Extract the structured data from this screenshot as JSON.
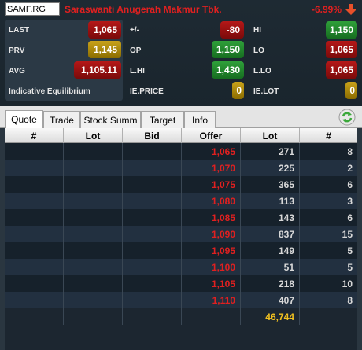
{
  "header": {
    "code": "SAMF.RG",
    "name": "Saraswanti Anugerah Makmur Tbk.",
    "change_pct": "-6.99%",
    "last_label": "LAST",
    "last_value": "1,065",
    "prv_label": "PRV",
    "prv_value": "1,145",
    "avg_label": "AVG",
    "avg_value": "1,105.11",
    "ie_label": "Indicative Equilibrium",
    "chg_label": "+/-",
    "chg_value": "-80",
    "op_label": "OP",
    "op_value": "1,150",
    "lhi_label": "L.HI",
    "lhi_value": "1,430",
    "ieprice_label": "IE.PRICE",
    "ieprice_value": "0",
    "hi_label": "HI",
    "hi_value": "1,150",
    "lo_label": "LO",
    "lo_value": "1,065",
    "llo_label": "L.LO",
    "llo_value": "1,065",
    "ielot_label": "IE.LOT",
    "ielot_value": "0"
  },
  "tabs": [
    "Quote",
    "Trade",
    "Stock Summ",
    "Target",
    "Info"
  ],
  "table": {
    "columns": [
      "#",
      "Lot",
      "Bid",
      "Offer",
      "Lot",
      "#"
    ],
    "rows": [
      {
        "offer": "1,065",
        "lot": "271",
        "count": "8"
      },
      {
        "offer": "1,070",
        "lot": "225",
        "count": "2"
      },
      {
        "offer": "1,075",
        "lot": "365",
        "count": "6"
      },
      {
        "offer": "1,080",
        "lot": "113",
        "count": "3"
      },
      {
        "offer": "1,085",
        "lot": "143",
        "count": "6"
      },
      {
        "offer": "1,090",
        "lot": "837",
        "count": "15"
      },
      {
        "offer": "1,095",
        "lot": "149",
        "count": "5"
      },
      {
        "offer": "1,100",
        "lot": "51",
        "count": "5"
      },
      {
        "offer": "1,105",
        "lot": "218",
        "count": "10"
      },
      {
        "offer": "1,110",
        "lot": "407",
        "count": "8"
      }
    ],
    "total_offer_lot": "46,744"
  },
  "colors": {
    "down": "#e02020",
    "up": "#2fa03a",
    "neutral": "#c9a21a",
    "total": "#f0c020"
  },
  "icons": {
    "change": "arrow-down-icon",
    "refresh": "refresh-icon"
  }
}
